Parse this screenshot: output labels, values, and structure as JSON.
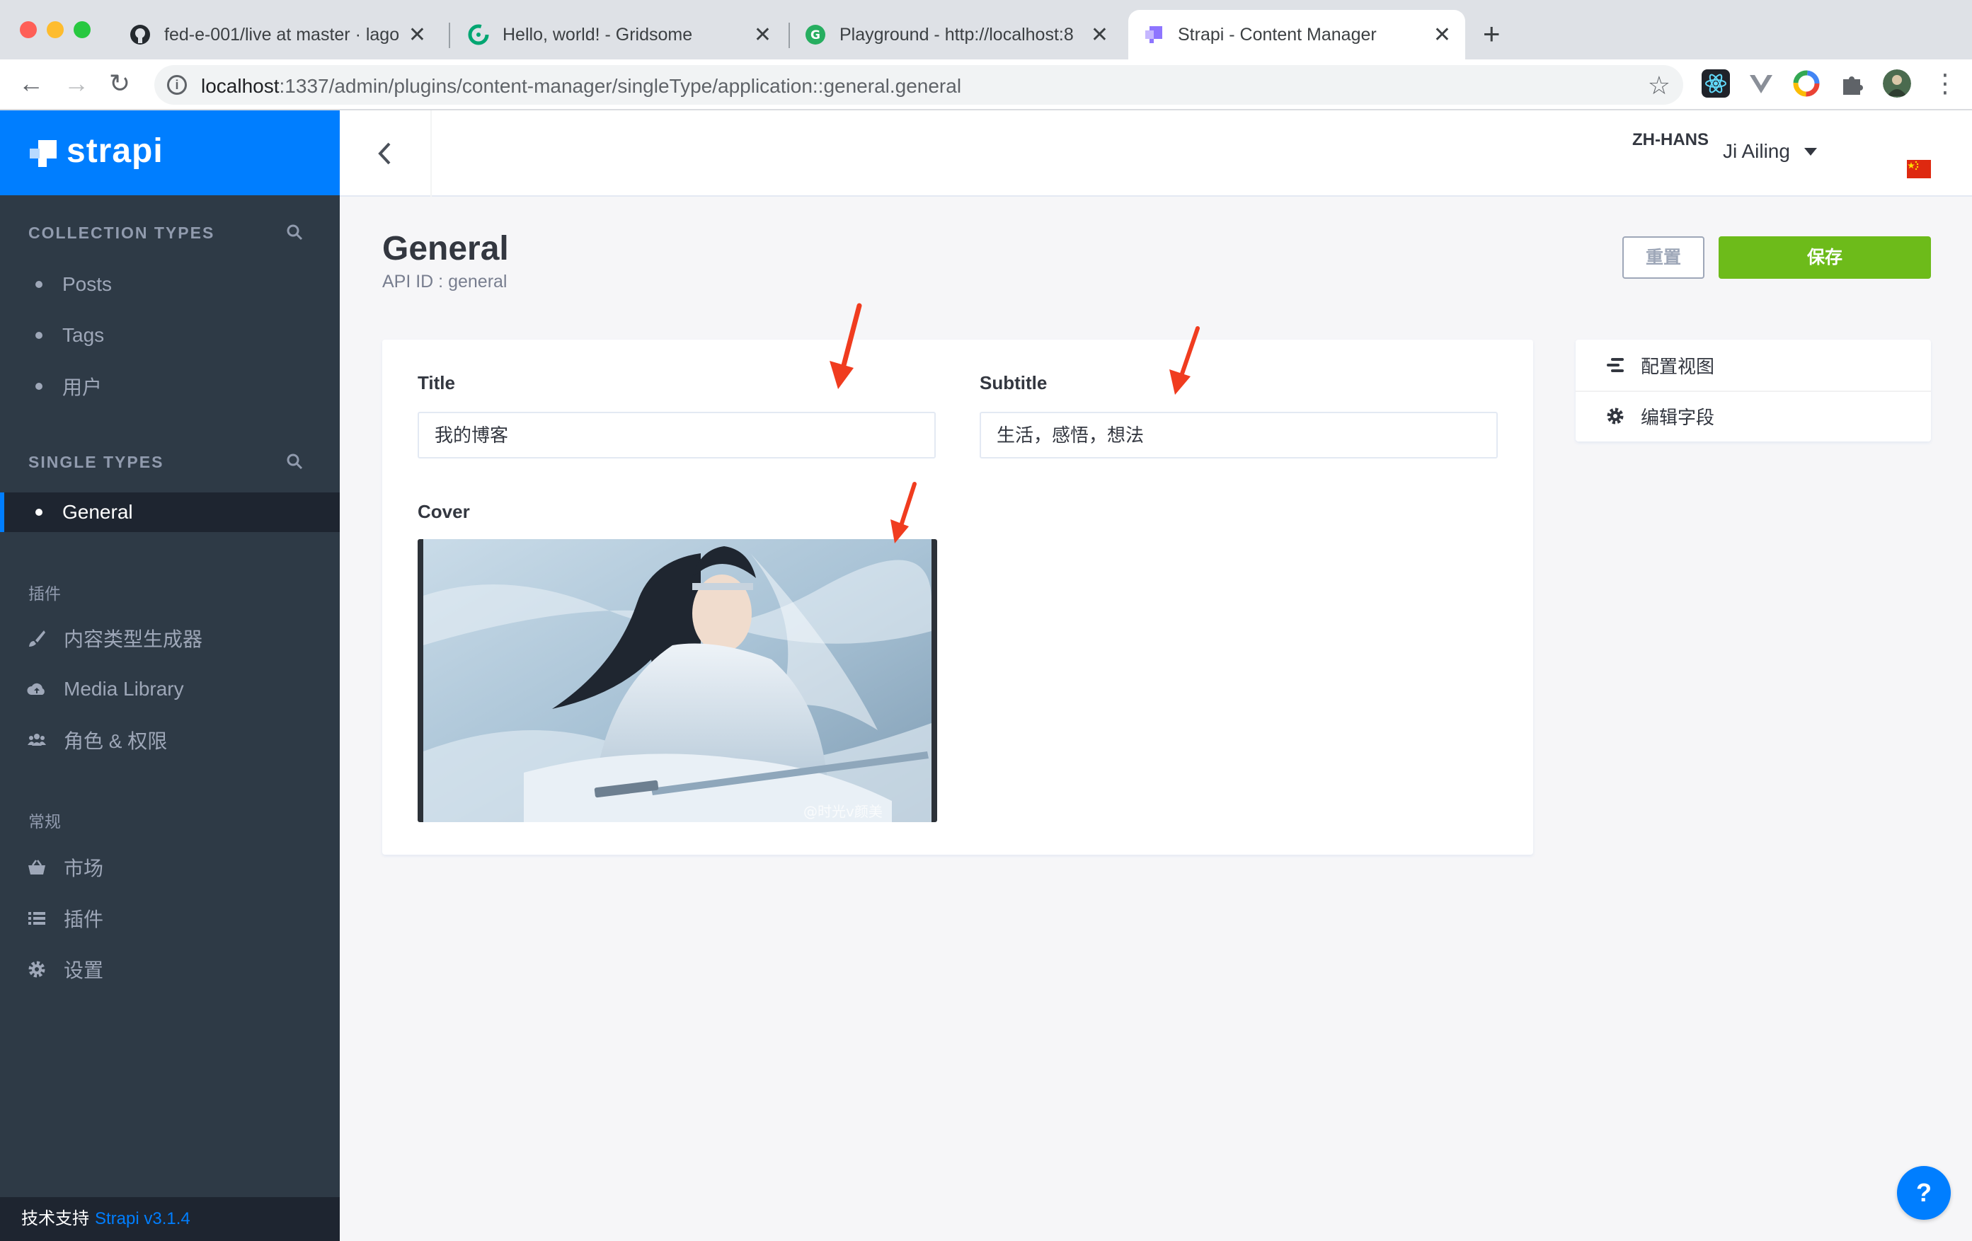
{
  "browser": {
    "tabs": [
      {
        "label": "fed-e-001/live at master · lago",
        "close": "✕"
      },
      {
        "label": "Hello, world! - Gridsome",
        "close": "✕"
      },
      {
        "label": "Playground - http://localhost:8",
        "close": "✕"
      },
      {
        "label": "Strapi - Content Manager",
        "close": "✕"
      }
    ],
    "new_tab": "+",
    "url_host": "localhost",
    "url_path": ":1337/admin/plugins/content-manager/singleType/application::general.general",
    "nav": {
      "back": "←",
      "forward": "→",
      "reload": "↻",
      "menu": "⋮"
    },
    "star": "☆"
  },
  "sidebar": {
    "logo": "strapi",
    "collection_types_title": "COLLECTION TYPES",
    "collection_types": [
      "Posts",
      "Tags",
      "用户"
    ],
    "single_types_title": "SINGLE TYPES",
    "single_types": [
      "General"
    ],
    "plugins_title": "插件",
    "plugins": [
      {
        "label": "内容类型生成器",
        "icon": "paint-brush-icon"
      },
      {
        "label": "Media Library",
        "icon": "cloud-upload-icon"
      },
      {
        "label": "角色 & 权限",
        "icon": "users-icon"
      }
    ],
    "general_title": "常规",
    "general": [
      {
        "label": "市场",
        "icon": "basket-icon"
      },
      {
        "label": "插件",
        "icon": "list-icon"
      },
      {
        "label": "设置",
        "icon": "gear-icon"
      }
    ],
    "footer_prefix": "技术支持",
    "footer_version": "Strapi v3.1.4"
  },
  "header": {
    "user": "Ji Ailing",
    "language": "ZH-HANS"
  },
  "page": {
    "title": "General",
    "api_id": "API ID : general",
    "reset_label": "重置",
    "save_label": "保存"
  },
  "form": {
    "title_label": "Title",
    "title_value": "我的博客",
    "subtitle_label": "Subtitle",
    "subtitle_value": "生活，感悟，想法",
    "cover_label": "Cover",
    "cover_watermark": "@时光v颜美"
  },
  "side_links": [
    {
      "label": "配置视图",
      "icon": "layout-icon"
    },
    {
      "label": "编辑字段",
      "icon": "gear-icon"
    }
  ],
  "help": "?",
  "colors": {
    "strapi_blue": "#007eff",
    "sidebar_bg": "#2e3a46",
    "save_green": "#6dbb1a",
    "annotation_red": "#f03c1f"
  }
}
